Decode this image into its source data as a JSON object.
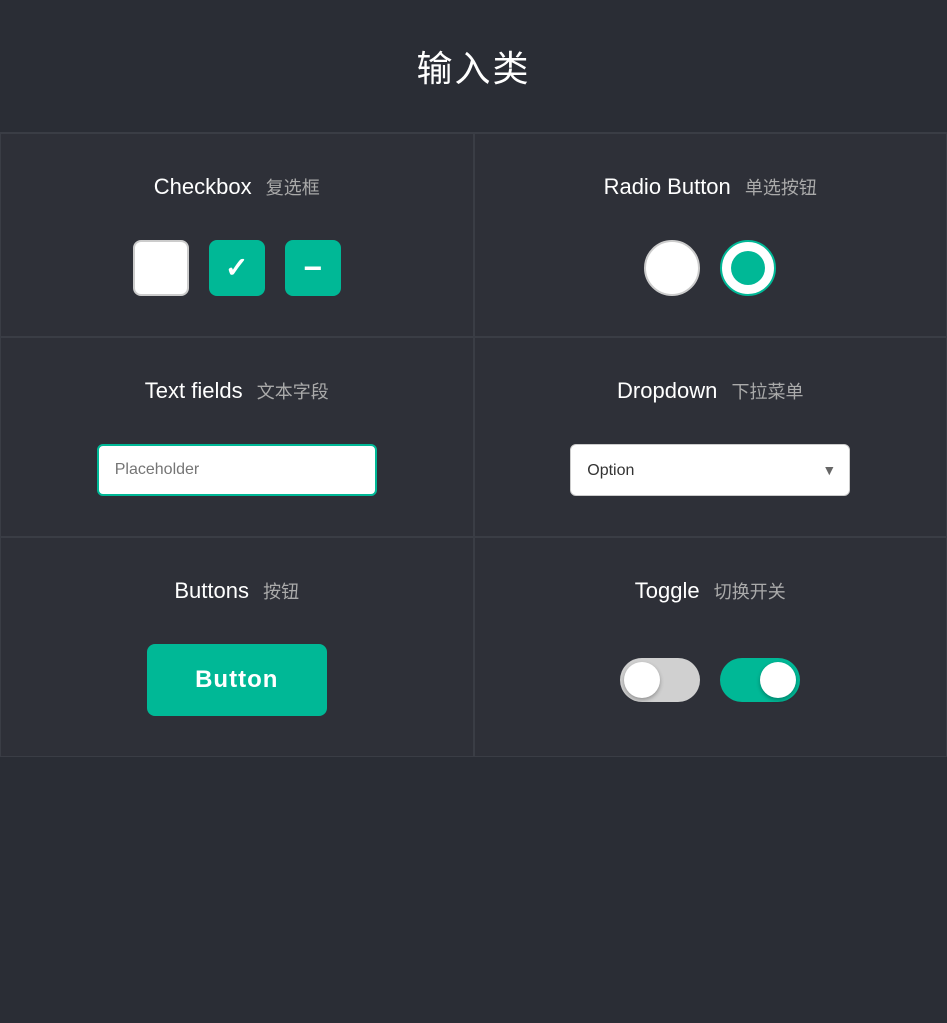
{
  "page": {
    "title": "输入类",
    "header_bg": "#2a2d35"
  },
  "sections": {
    "checkbox": {
      "title_en": "Checkbox",
      "title_zh": "复选框"
    },
    "radio": {
      "title_en": "Radio Button",
      "title_zh": "单选按钮"
    },
    "textfield": {
      "title_en": "Text fields",
      "title_zh": "文本字段",
      "placeholder": "Placeholder"
    },
    "dropdown": {
      "title_en": "Dropdown",
      "title_zh": "下拉菜单",
      "option_label": "Option"
    },
    "buttons": {
      "title_en": "Buttons",
      "title_zh": "按钮",
      "button_label": "Button"
    },
    "toggle": {
      "title_en": "Toggle",
      "title_zh": "切换开关"
    }
  },
  "colors": {
    "accent": "#00b896",
    "bg_dark": "#2e3038",
    "text_primary": "#ffffff",
    "text_muted": "#aaaaaa"
  }
}
